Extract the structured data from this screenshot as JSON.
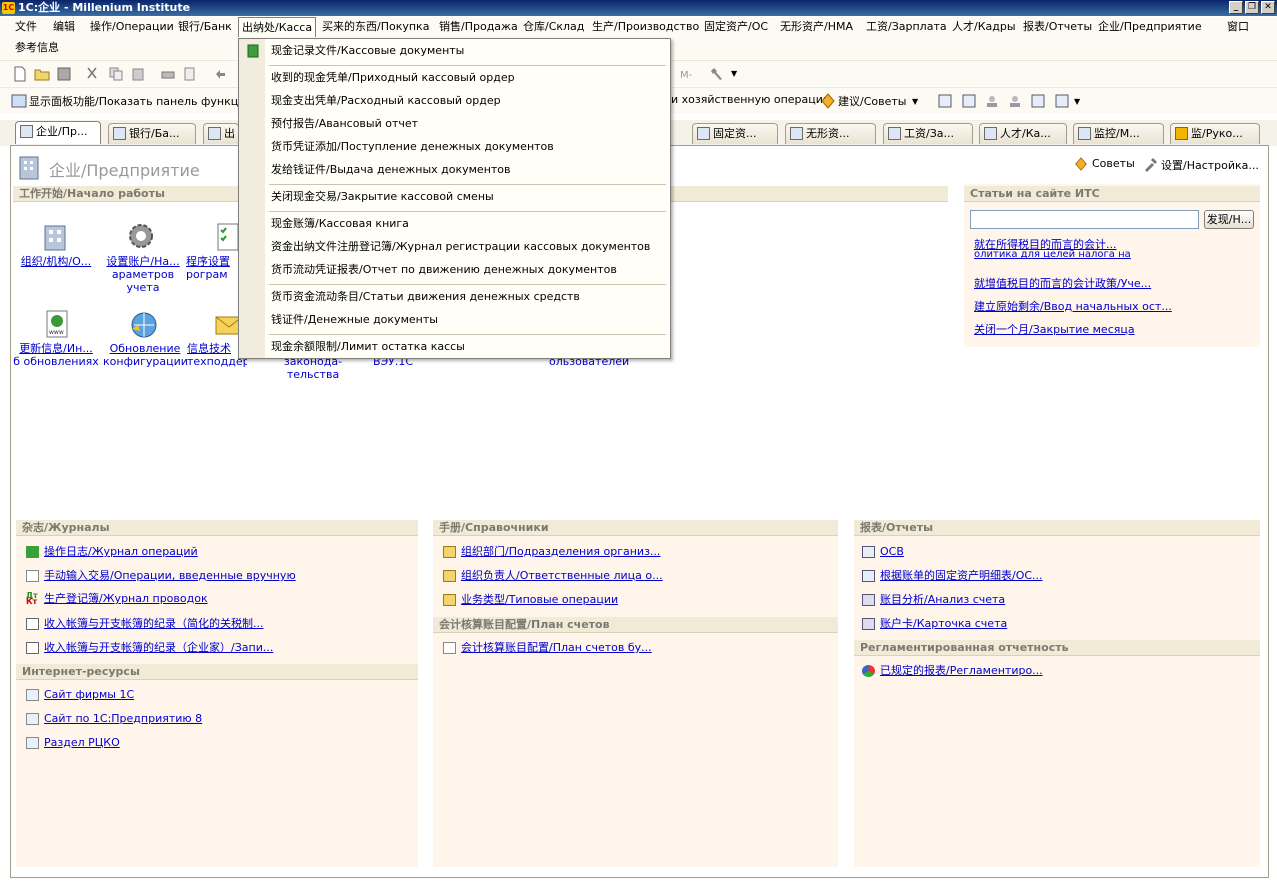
{
  "window": {
    "title": "1C:企业 - Millenium Institute",
    "logo": "1C"
  },
  "menu": {
    "items": [
      "文件",
      "编辑",
      "操作/Операции",
      "银行/Банк",
      "出纳处/Касса",
      "买来的东西/Покупка",
      "销售/Продажа",
      "仓库/Склад",
      "生产/Производство",
      "固定资产/ОС",
      "无形资产/НМА",
      "工资/Зарплата",
      "人才/Кадры",
      "报表/Отчеты",
      "企业/Предприятие",
      "窗口"
    ],
    "second_row": "参考信息"
  },
  "toolbar2": {
    "panel_label": "显示面板功能/Показать панель функци",
    "operation_label": "и хозяйственную операцию",
    "advice_label": "建议/Советы"
  },
  "tabs": [
    "企业/Пр...",
    "银行/Ба...",
    "出",
    "固定资...",
    "无形资...",
    "工资/За...",
    "人才/Ка...",
    "监控/М...",
    "监/Руко..."
  ],
  "page": {
    "title": "企业/Предприятие",
    "advice": "Советы",
    "settings": "设置/Настройка..."
  },
  "start": {
    "head": "工作开始/Начало работы",
    "icons": [
      {
        "l1": "组织/机构/О...",
        "l2": "",
        "l3": ""
      },
      {
        "l1": "设置账户/На...",
        "l2": "араметров",
        "l3": "учета"
      },
      {
        "l1": "程序设置",
        "l2": "рограм",
        "l3": ""
      },
      {
        "l1": "更新信息/Ин...",
        "l2": "б обновлениях",
        "l3": ""
      },
      {
        "l1": "Обновление",
        "l2": "конфигурации",
        "l3": ""
      },
      {
        "l1": "信息技术",
        "l2": "техподдержку",
        "l3": ""
      }
    ],
    "hidden_labels": [
      "законода-",
      "тельства",
      "ВЭУ.1С",
      "ользователей"
    ]
  },
  "its": {
    "head": "Статьи на сайте ИТС",
    "search_value": "",
    "search_button": "发现/Н...",
    "links": [
      "就在所得税目的而言的会计...",
      "олитика для целей налога на",
      "就增值税目的而言的会计政策/Уче...",
      "建立原始剩余/Ввод начальных ост...",
      "关闭一个月/Закрытие месяца"
    ]
  },
  "journals": {
    "head": "杂志/Журналы",
    "links": [
      "操作日志/Журнал операций",
      "手动输入交易/Операции, введенные вручную",
      "生产登记簿/Журнал проводок",
      "收入帐簿与开支帐簿的纪录（简化的关税制...",
      "收入帐簿与开支帐簿的纪录（企业家）/Запи..."
    ]
  },
  "internet": {
    "head": "Интернет-ресурсы",
    "links": [
      "Сайт фирмы 1С",
      "Сайт по 1С:Предприятию 8",
      "Раздел РЦКО"
    ]
  },
  "refs": {
    "head": "手册/Справочники",
    "links": [
      "组织部门/Подразделения организ...",
      "组织负责人/Ответственные лица о...",
      "业务类型/Типовые операции"
    ]
  },
  "accounts": {
    "head": "会计核算账目配置/План счетов",
    "links": [
      "会计核算账目配置/План счетов бу..."
    ]
  },
  "reports": {
    "head": "报表/Отчеты",
    "links": [
      "ОСВ",
      "根据账单的固定资产明细表/ОС...",
      "账目分析/Анализ счета",
      "账户卡/Карточка счета"
    ]
  },
  "regl": {
    "head": "Регламентированная отчетность",
    "links": [
      "已规定的报表/Регламентиро..."
    ]
  },
  "dropdown": {
    "items": [
      "现金记录文件/Кассовые документы",
      "收到的现金凭单/Приходный кассовый ордер",
      "现金支出凭单/Расходный кассовый ордер",
      "预付报告/Авансовый отчет",
      "货币凭证添加/Поступление денежных документов",
      "发给钱证件/Выдача денежных документов",
      "关闭现金交易/Закрытие кассовой смены",
      "现金账簿/Кассовая книга",
      "资金出纳文件注册登记簿/Журнал регистрации кассовых документов",
      "货币流动凭证报表/Отчет по движению денежных документов",
      "货币资金流动条目/Статьи движения денежных средств",
      "钱证件/Денежные документы",
      "现金余额限制/Лимит остатка кассы"
    ]
  },
  "colors": {
    "link": "#0000cc",
    "section_head": "#f0ead7",
    "panel": "#fff5ea",
    "titlebar": "#0a246a"
  }
}
